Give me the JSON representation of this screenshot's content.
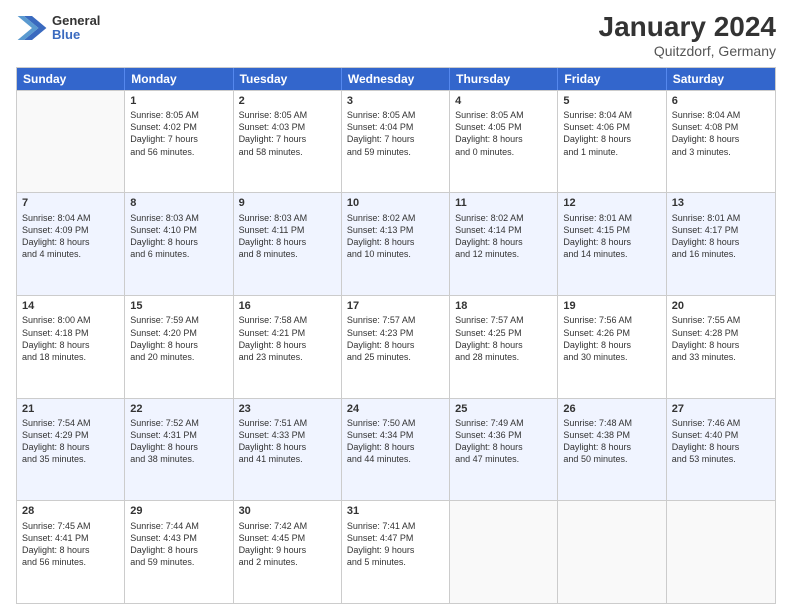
{
  "header": {
    "logo_general": "General",
    "logo_blue": "Blue",
    "main_title": "January 2024",
    "subtitle": "Quitzdorf, Germany"
  },
  "calendar": {
    "days": [
      "Sunday",
      "Monday",
      "Tuesday",
      "Wednesday",
      "Thursday",
      "Friday",
      "Saturday"
    ],
    "rows": [
      [
        {
          "day": "",
          "info": ""
        },
        {
          "day": "1",
          "info": "Sunrise: 8:05 AM\nSunset: 4:02 PM\nDaylight: 7 hours\nand 56 minutes."
        },
        {
          "day": "2",
          "info": "Sunrise: 8:05 AM\nSunset: 4:03 PM\nDaylight: 7 hours\nand 58 minutes."
        },
        {
          "day": "3",
          "info": "Sunrise: 8:05 AM\nSunset: 4:04 PM\nDaylight: 7 hours\nand 59 minutes."
        },
        {
          "day": "4",
          "info": "Sunrise: 8:05 AM\nSunset: 4:05 PM\nDaylight: 8 hours\nand 0 minutes."
        },
        {
          "day": "5",
          "info": "Sunrise: 8:04 AM\nSunset: 4:06 PM\nDaylight: 8 hours\nand 1 minute."
        },
        {
          "day": "6",
          "info": "Sunrise: 8:04 AM\nSunset: 4:08 PM\nDaylight: 8 hours\nand 3 minutes."
        }
      ],
      [
        {
          "day": "7",
          "info": "Sunrise: 8:04 AM\nSunset: 4:09 PM\nDaylight: 8 hours\nand 4 minutes."
        },
        {
          "day": "8",
          "info": "Sunrise: 8:03 AM\nSunset: 4:10 PM\nDaylight: 8 hours\nand 6 minutes."
        },
        {
          "day": "9",
          "info": "Sunrise: 8:03 AM\nSunset: 4:11 PM\nDaylight: 8 hours\nand 8 minutes."
        },
        {
          "day": "10",
          "info": "Sunrise: 8:02 AM\nSunset: 4:13 PM\nDaylight: 8 hours\nand 10 minutes."
        },
        {
          "day": "11",
          "info": "Sunrise: 8:02 AM\nSunset: 4:14 PM\nDaylight: 8 hours\nand 12 minutes."
        },
        {
          "day": "12",
          "info": "Sunrise: 8:01 AM\nSunset: 4:15 PM\nDaylight: 8 hours\nand 14 minutes."
        },
        {
          "day": "13",
          "info": "Sunrise: 8:01 AM\nSunset: 4:17 PM\nDaylight: 8 hours\nand 16 minutes."
        }
      ],
      [
        {
          "day": "14",
          "info": "Sunrise: 8:00 AM\nSunset: 4:18 PM\nDaylight: 8 hours\nand 18 minutes."
        },
        {
          "day": "15",
          "info": "Sunrise: 7:59 AM\nSunset: 4:20 PM\nDaylight: 8 hours\nand 20 minutes."
        },
        {
          "day": "16",
          "info": "Sunrise: 7:58 AM\nSunset: 4:21 PM\nDaylight: 8 hours\nand 23 minutes."
        },
        {
          "day": "17",
          "info": "Sunrise: 7:57 AM\nSunset: 4:23 PM\nDaylight: 8 hours\nand 25 minutes."
        },
        {
          "day": "18",
          "info": "Sunrise: 7:57 AM\nSunset: 4:25 PM\nDaylight: 8 hours\nand 28 minutes."
        },
        {
          "day": "19",
          "info": "Sunrise: 7:56 AM\nSunset: 4:26 PM\nDaylight: 8 hours\nand 30 minutes."
        },
        {
          "day": "20",
          "info": "Sunrise: 7:55 AM\nSunset: 4:28 PM\nDaylight: 8 hours\nand 33 minutes."
        }
      ],
      [
        {
          "day": "21",
          "info": "Sunrise: 7:54 AM\nSunset: 4:29 PM\nDaylight: 8 hours\nand 35 minutes."
        },
        {
          "day": "22",
          "info": "Sunrise: 7:52 AM\nSunset: 4:31 PM\nDaylight: 8 hours\nand 38 minutes."
        },
        {
          "day": "23",
          "info": "Sunrise: 7:51 AM\nSunset: 4:33 PM\nDaylight: 8 hours\nand 41 minutes."
        },
        {
          "day": "24",
          "info": "Sunrise: 7:50 AM\nSunset: 4:34 PM\nDaylight: 8 hours\nand 44 minutes."
        },
        {
          "day": "25",
          "info": "Sunrise: 7:49 AM\nSunset: 4:36 PM\nDaylight: 8 hours\nand 47 minutes."
        },
        {
          "day": "26",
          "info": "Sunrise: 7:48 AM\nSunset: 4:38 PM\nDaylight: 8 hours\nand 50 minutes."
        },
        {
          "day": "27",
          "info": "Sunrise: 7:46 AM\nSunset: 4:40 PM\nDaylight: 8 hours\nand 53 minutes."
        }
      ],
      [
        {
          "day": "28",
          "info": "Sunrise: 7:45 AM\nSunset: 4:41 PM\nDaylight: 8 hours\nand 56 minutes."
        },
        {
          "day": "29",
          "info": "Sunrise: 7:44 AM\nSunset: 4:43 PM\nDaylight: 8 hours\nand 59 minutes."
        },
        {
          "day": "30",
          "info": "Sunrise: 7:42 AM\nSunset: 4:45 PM\nDaylight: 9 hours\nand 2 minutes."
        },
        {
          "day": "31",
          "info": "Sunrise: 7:41 AM\nSunset: 4:47 PM\nDaylight: 9 hours\nand 5 minutes."
        },
        {
          "day": "",
          "info": ""
        },
        {
          "day": "",
          "info": ""
        },
        {
          "day": "",
          "info": ""
        }
      ]
    ]
  }
}
